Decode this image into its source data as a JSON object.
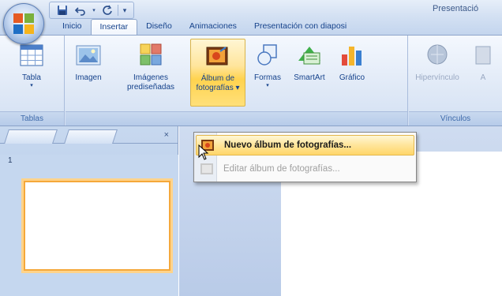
{
  "window": {
    "title": "Presentació"
  },
  "quick_access": {
    "items": [
      "save-icon",
      "undo-icon",
      "redo-icon",
      "customize-arrow-icon"
    ]
  },
  "tabs": [
    {
      "label": "Inicio",
      "active": false
    },
    {
      "label": "Insertar",
      "active": true
    },
    {
      "label": "Diseño",
      "active": false
    },
    {
      "label": "Animaciones",
      "active": false
    },
    {
      "label": "Presentación con diaposi",
      "active": false
    }
  ],
  "ribbon": {
    "groups": {
      "tables": {
        "label": "Tablas"
      },
      "links": {
        "label": "Vínculos"
      }
    },
    "buttons": {
      "table": {
        "line1": "Tabla",
        "line2": "▾"
      },
      "image": {
        "line1": "Imagen",
        "line2": ""
      },
      "clipart": {
        "line1": "Imágenes",
        "line2": "prediseñadas"
      },
      "photo_album": {
        "line1": "Álbum de",
        "line2": "fotografías ▾"
      },
      "shapes": {
        "line1": "Formas",
        "line2": "▾"
      },
      "smartart": {
        "line1": "SmartArt",
        "line2": ""
      },
      "chart": {
        "line1": "Gráfico",
        "line2": ""
      },
      "hyperlink": {
        "line1": "Hipervínculo",
        "line2": ""
      },
      "action": {
        "line1": "A",
        "line2": ""
      }
    }
  },
  "left_pane": {
    "close_glyph": "×",
    "slide_number": "1"
  },
  "menu": {
    "items": [
      {
        "label": "Nuevo álbum de fotografías...",
        "enabled": true,
        "highlighted": true
      },
      {
        "label": "Editar álbum de fotografías...",
        "enabled": false,
        "highlighted": false
      }
    ]
  },
  "colors": {
    "accent": "#15428b",
    "ribbon_light": "#e1eaf7",
    "hover_yellow": "#ffd34f",
    "selection_orange": "#f5a83b"
  }
}
